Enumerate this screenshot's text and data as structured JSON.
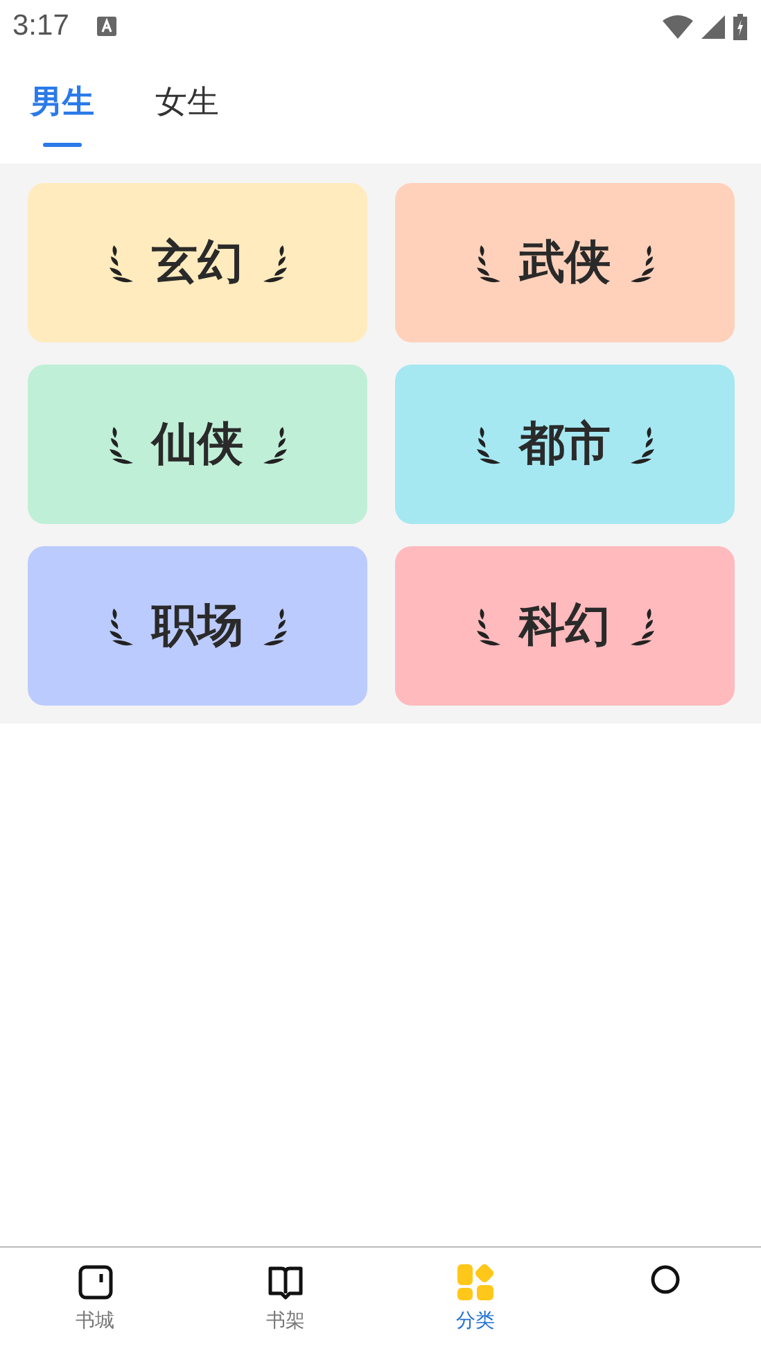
{
  "status_bar": {
    "time": "3:17"
  },
  "tabs": [
    {
      "label": "男生",
      "selected": true
    },
    {
      "label": "女生",
      "selected": false
    }
  ],
  "categories": [
    {
      "label": "玄幻",
      "color": "#ffebbd"
    },
    {
      "label": "武侠",
      "color": "#ffd1bb"
    },
    {
      "label": "仙侠",
      "color": "#c0efd8"
    },
    {
      "label": "都市",
      "color": "#a5e8f2"
    },
    {
      "label": "职场",
      "color": "#bccbfd"
    },
    {
      "label": "科幻",
      "color": "#ffbabd"
    }
  ],
  "bottom_nav": [
    {
      "kind": "store",
      "label": "书城",
      "selected": false
    },
    {
      "kind": "shelf",
      "label": "书架",
      "selected": false
    },
    {
      "kind": "category",
      "label": "分类",
      "selected": true
    },
    {
      "kind": "profile",
      "selected": false
    }
  ]
}
